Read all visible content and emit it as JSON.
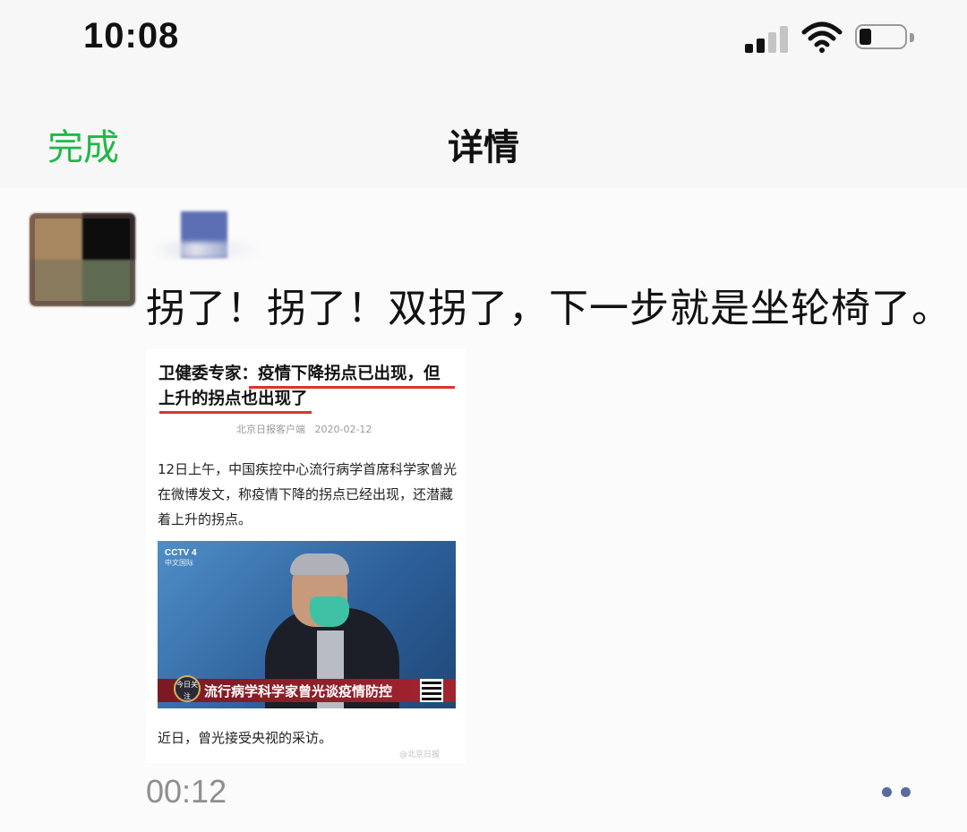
{
  "status_bar": {
    "time": "10:08",
    "signal_icon": "cellular-signal-icon",
    "wifi_icon": "wifi-icon",
    "battery_icon": "battery-icon",
    "battery_level": 0.2
  },
  "nav": {
    "done_label": "完成",
    "title": "详情"
  },
  "post": {
    "text": "拐了！拐了！双拐了，下一步就是坐轮椅了。",
    "duration": "00:12",
    "more_icon": "more-dots-icon"
  },
  "embedded": {
    "headline_prefix": "卫健委专家：",
    "headline_highlight_1": "疫情下降拐点已出现，但",
    "headline_highlight_2": "上升的拐点也出现了",
    "source": "北京日报客户端",
    "date": "2020-02-12",
    "paragraph": "12日上午，中国疾控中心流行病学首席科学家曾光在微博发文，称疫情下降的拐点已经出现，还潜藏着上升的拐点。",
    "video": {
      "channel": "CCTV 4",
      "channel_sub": "中文国际",
      "logo_text": "今日关注",
      "caption": "流行病学科学家曾光谈疫情防控"
    },
    "footer": "近日，曾光接受央视的采访。",
    "watermark": "@北京日报"
  },
  "colors": {
    "done_green": "#20b84a",
    "highlight_red": "#d8362c",
    "more_dots": "#5a6b9a"
  }
}
